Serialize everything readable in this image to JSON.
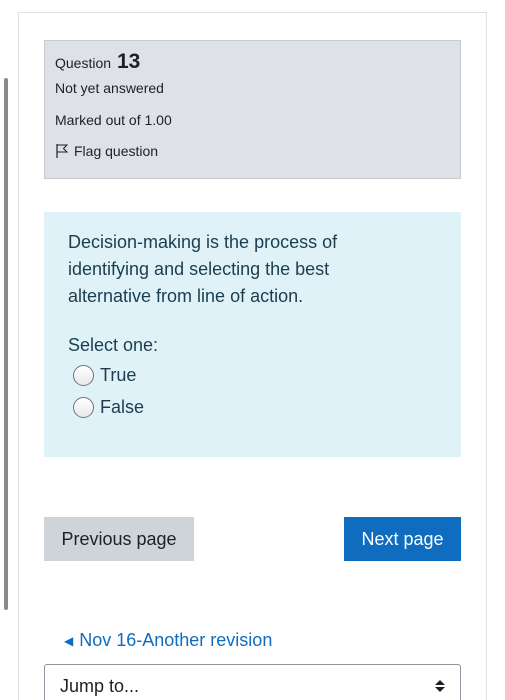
{
  "question": {
    "label": "Question",
    "number": "13",
    "status": "Not yet answered",
    "marks": "Marked out of 1.00",
    "flag_label": "Flag question"
  },
  "content": {
    "text": "Decision-making is the process of identifying and selecting the best alternative from line of action.",
    "prompt": "Select one:",
    "options": [
      {
        "label": "True"
      },
      {
        "label": "False"
      }
    ]
  },
  "navigation": {
    "previous_label": "Previous page",
    "next_label": "Next page",
    "back_link": "Nov 16-Another revision",
    "jump_label": "Jump to..."
  },
  "colors": {
    "info_bg": "#dee2e6",
    "content_bg": "#def2f8",
    "primary": "#0f6cbf"
  }
}
